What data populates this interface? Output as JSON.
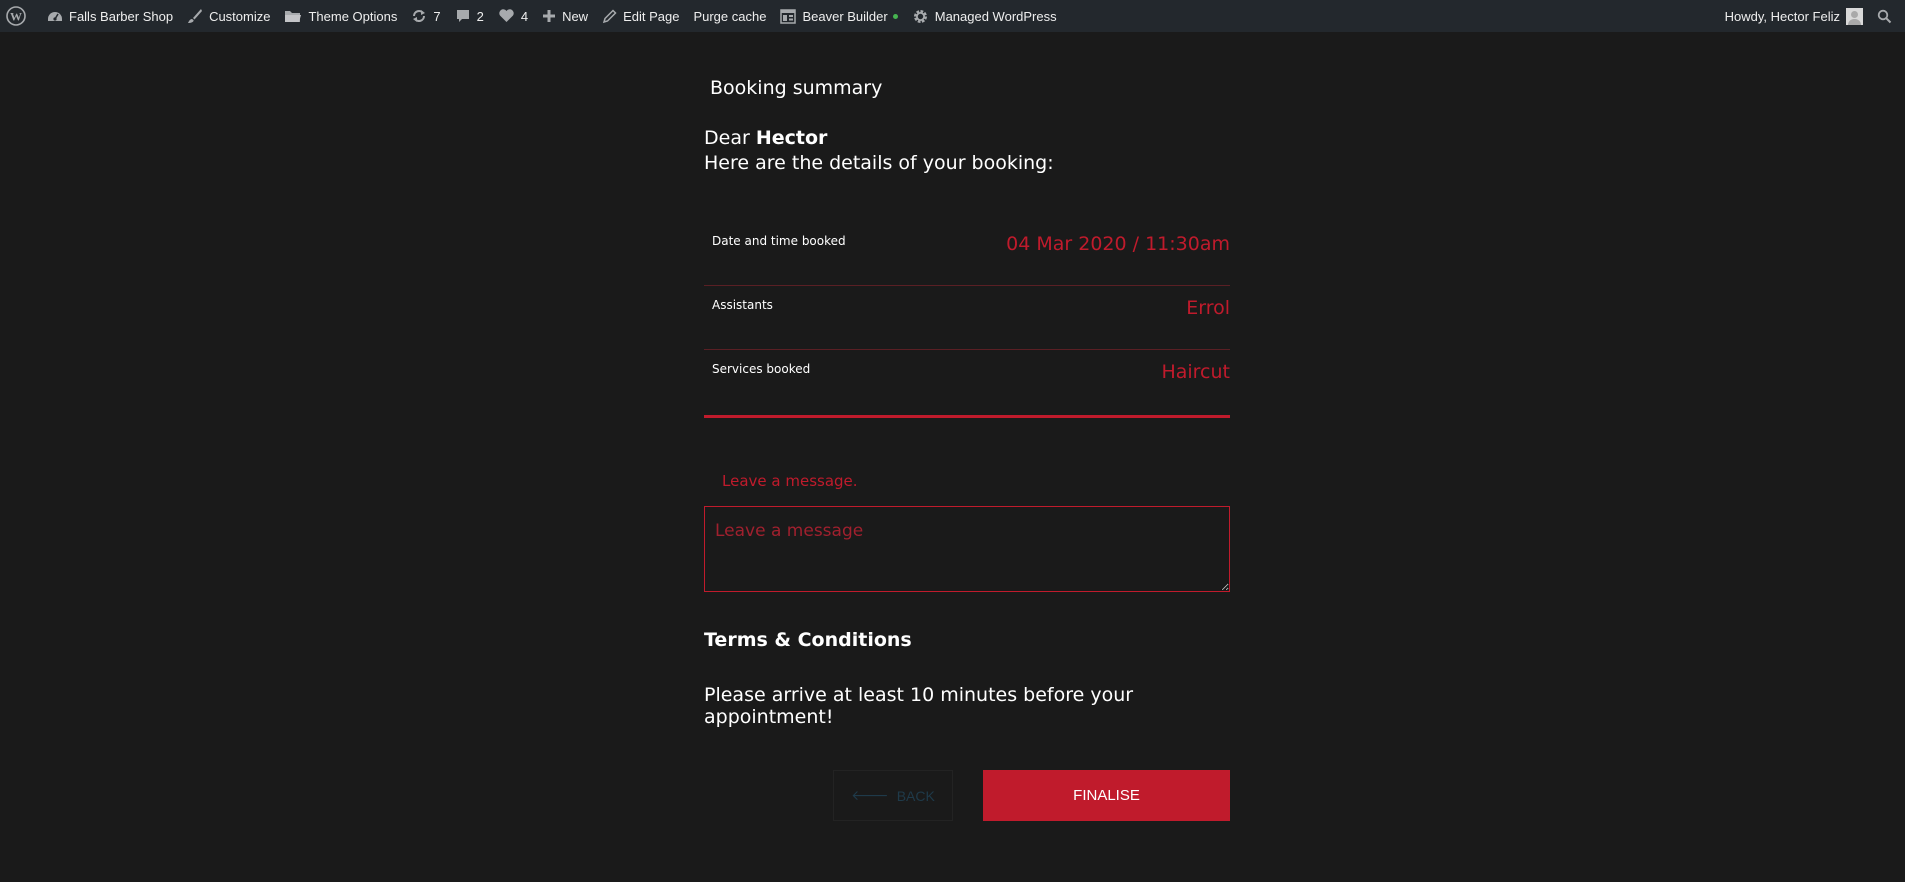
{
  "admin_bar": {
    "site_name": "Falls Barber Shop",
    "customize": "Customize",
    "theme_options": "Theme Options",
    "updates_count": "7",
    "comments_count": "2",
    "likes_count": "4",
    "new_label": "New",
    "edit_page": "Edit Page",
    "purge_cache": "Purge cache",
    "beaver_builder": "Beaver Builder",
    "managed_wp": "Managed WordPress",
    "howdy": "Howdy, Hector Feliz"
  },
  "summary": {
    "title": "Booking summary",
    "dear": "Dear",
    "customer_name": "Hector",
    "intro": "Here are the details of your booking:",
    "rows": [
      {
        "label": "Date and time booked",
        "value": "04 Mar 2020 / 11:30am"
      },
      {
        "label": "Assistants",
        "value": "Errol"
      },
      {
        "label": "Services booked",
        "value": "Haircut"
      }
    ]
  },
  "message": {
    "label": "Leave a message.",
    "placeholder": "Leave a message"
  },
  "terms": {
    "title": "Terms & Conditions",
    "text": "Please arrive at least 10 minutes before your appointment!"
  },
  "buttons": {
    "back": "BACK",
    "finalise": "FINALISE"
  },
  "colors": {
    "accent": "#c01b2c",
    "background": "#1a1a1a",
    "admin_bar": "#23282d"
  }
}
